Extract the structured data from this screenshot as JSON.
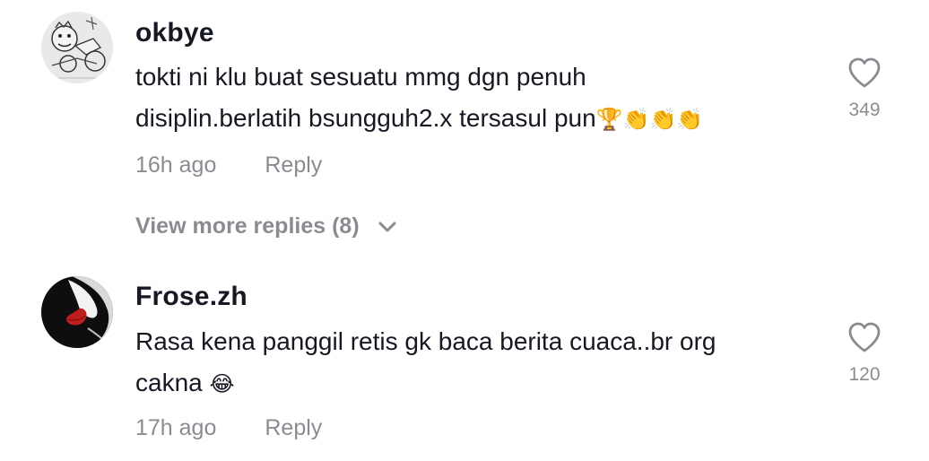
{
  "comments": [
    {
      "username": "okbye",
      "text_line1": "tokti ni klu buat sesuatu mmg dgn penuh",
      "text_line2": "disiplin.berlatih bsungguh2.x tersasul pun",
      "emojis": "🏆👏👏👏",
      "avatar_icon": "cartoon-sketch-avatar",
      "time": "16h ago",
      "reply_label": "Reply",
      "likes": "349"
    },
    {
      "username": "Frose.zh",
      "text_line1": "Rasa kena panggil retis gk baca berita cuaca..br org",
      "text_line2": "cakna",
      "emojis": "😂",
      "avatar_icon": "face-red-lips-avatar",
      "time": "17h ago",
      "reply_label": "Reply",
      "likes": "120"
    }
  ],
  "view_more": {
    "label": "View more replies (8)"
  },
  "colors": {
    "text_primary": "#161823",
    "text_secondary": "#8a8b91",
    "background": "#ffffff"
  }
}
